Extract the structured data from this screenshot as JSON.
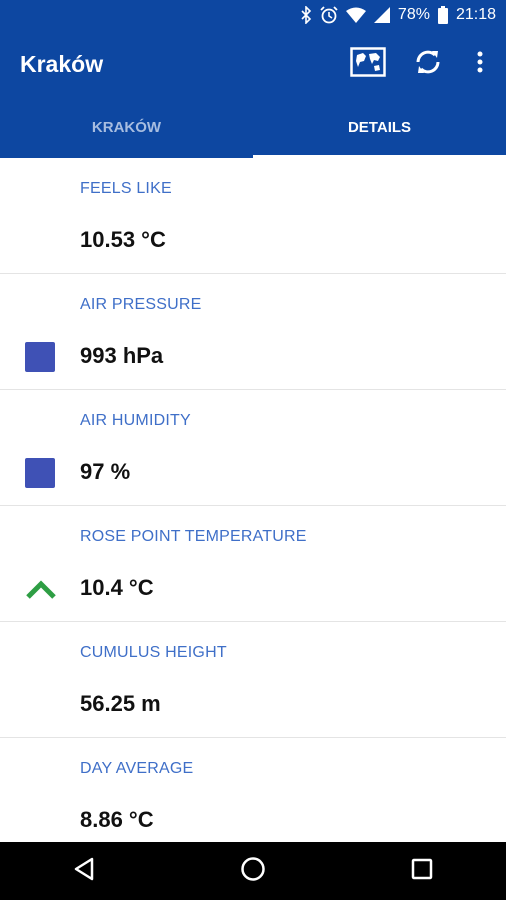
{
  "status_bar": {
    "battery": "78%",
    "time": "21:18"
  },
  "app_bar": {
    "title": "Kraków"
  },
  "tabs": [
    {
      "label": "KRAKÓW"
    },
    {
      "label": "DETAILS"
    }
  ],
  "details": [
    {
      "label": "FEELS LIKE",
      "value": "10.53 °C",
      "indicator": "none"
    },
    {
      "label": "AIR PRESSURE",
      "value": "993 hPa",
      "indicator": "square"
    },
    {
      "label": "AIR HUMIDITY",
      "value": "97 %",
      "indicator": "square"
    },
    {
      "label": "ROSE POINT TEMPERATURE",
      "value": "10.4 °C",
      "indicator": "arrow-up"
    },
    {
      "label": "CUMULUS HEIGHT",
      "value": "56.25 m",
      "indicator": "none"
    },
    {
      "label": "DAY AVERAGE",
      "value": "8.86 °C",
      "indicator": "none"
    }
  ],
  "colors": {
    "primary": "#0d47a1",
    "label": "#3f6fc8",
    "square": "#3f51b5",
    "arrow_up": "#2e9e44"
  }
}
